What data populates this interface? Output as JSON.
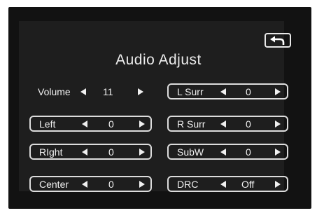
{
  "title": "Audio Adjust",
  "back_icon": "return-arrow-icon",
  "settings": {
    "volume": {
      "label": "Volume",
      "value": "11"
    },
    "l_surr": {
      "label": "L Surr",
      "value": "0"
    },
    "left": {
      "label": "Left",
      "value": "0"
    },
    "r_surr": {
      "label": "R Surr",
      "value": "0"
    },
    "right": {
      "label": "RIght",
      "value": "0"
    },
    "subw": {
      "label": "SubW",
      "value": "0"
    },
    "center": {
      "label": "Center",
      "value": "0"
    },
    "drc": {
      "label": "DRC",
      "value": "Off"
    }
  }
}
